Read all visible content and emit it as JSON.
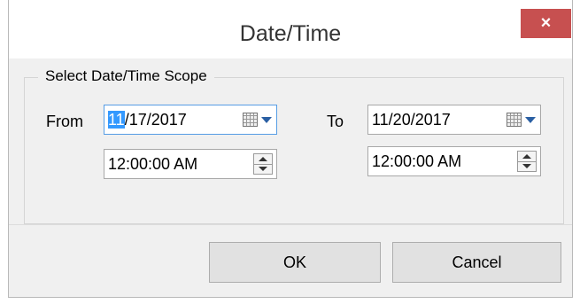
{
  "dialog": {
    "title": "Date/Time",
    "close_symbol": "×"
  },
  "group": {
    "title": "Select Date/Time Scope"
  },
  "from": {
    "label": "From",
    "date_selected": "11",
    "date_rest": "/17/2017",
    "time": "12:00:00 AM"
  },
  "to": {
    "label": "To",
    "date": "11/20/2017",
    "time": "12:00:00 AM"
  },
  "buttons": {
    "ok": "OK",
    "cancel": "Cancel"
  },
  "icons": {
    "calendar": "calendar-icon",
    "spin_up": "spin-up-icon",
    "spin_down": "spin-down-icon",
    "close": "close-icon"
  },
  "colors": {
    "close_bg": "#c75050",
    "selection": "#3399ff",
    "focus_border": "#569de5"
  }
}
